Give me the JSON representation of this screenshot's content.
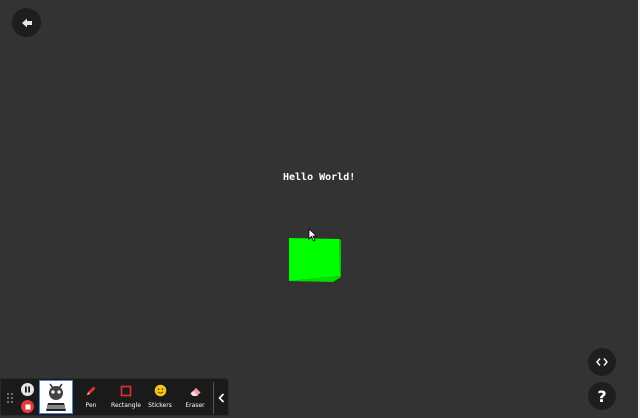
{
  "canvas": {
    "text": "Hello World!",
    "background": "#333333",
    "cube_color": "#00ff00"
  },
  "controls": {
    "back_icon": "arrow-left-icon",
    "code_icon": "code-icon",
    "help_label": "?"
  },
  "toolbar": {
    "tools": [
      {
        "label": "Pen",
        "icon": "pen-icon",
        "color": "#e03030"
      },
      {
        "label": "Rectangle",
        "icon": "rectangle-icon",
        "color": "#e03030"
      },
      {
        "label": "Stickers",
        "icon": "smiley-icon",
        "color": "#f5c518"
      },
      {
        "label": "Eraser",
        "icon": "eraser-icon",
        "color": "#f0a0a8"
      }
    ],
    "record_stop_color": "#e53a3a",
    "collapse_icon": "chevron-left-icon"
  }
}
